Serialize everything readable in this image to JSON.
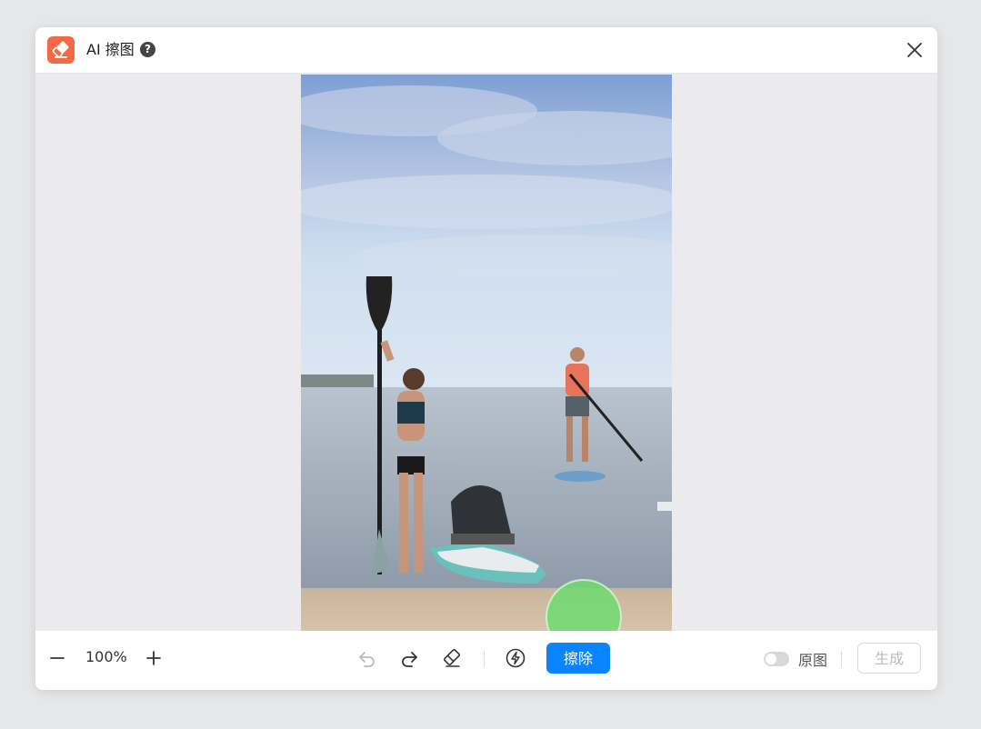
{
  "dialog": {
    "title": "AI 擦图",
    "help_icon": "question-circle-icon",
    "close_icon": "close-icon",
    "app_icon": "eraser-icon",
    "accent": "#f26a45"
  },
  "canvas": {
    "image_description_icon": "photo",
    "brush_color": "#6edc6e"
  },
  "toolbar": {
    "zoom_value": "100%",
    "zoom_out_icon": "minus-icon",
    "zoom_in_icon": "plus-icon",
    "undo_icon": "undo-icon",
    "redo_icon": "redo-icon",
    "eraser_icon": "eraser-icon",
    "quick_icon": "lightning-icon",
    "erase_label": "擦除",
    "erase_color": "#0a84ff",
    "original_label": "原图",
    "generate_label": "生成"
  }
}
